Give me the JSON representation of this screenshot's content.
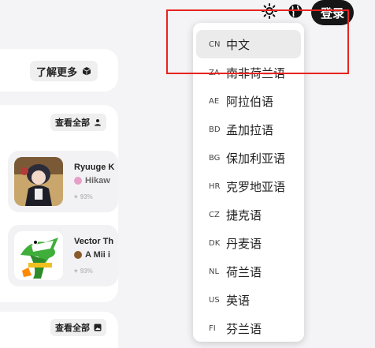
{
  "header": {
    "login_label": "登录",
    "theme_icon": "sun-icon",
    "language_icon": "globe-icon"
  },
  "section1": {
    "more_label": "了解更多"
  },
  "section2": {
    "view_all_label": "查看全部",
    "items": [
      {
        "title": "Ryuuge K",
        "author": "Hikaw",
        "rating": "93%"
      },
      {
        "title": "Vector Th",
        "author": "A Mii i",
        "rating": "93%"
      }
    ]
  },
  "section3": {
    "view_all_label": "查看全部"
  },
  "languages": [
    {
      "code": "CN",
      "name": "中文",
      "active": true
    },
    {
      "code": "ZA",
      "name": "南非荷兰语"
    },
    {
      "code": "AE",
      "name": "阿拉伯语"
    },
    {
      "code": "BD",
      "name": "孟加拉语"
    },
    {
      "code": "BG",
      "name": "保加利亚语"
    },
    {
      "code": "HR",
      "name": "克罗地亚语"
    },
    {
      "code": "CZ",
      "name": "捷克语"
    },
    {
      "code": "DK",
      "name": "丹麦语"
    },
    {
      "code": "NL",
      "name": "荷兰语"
    },
    {
      "code": "US",
      "name": "英语"
    },
    {
      "code": "FI",
      "name": "芬兰语"
    }
  ],
  "colors": {
    "highlight": "#e8231f",
    "button_dark": "#161616"
  }
}
